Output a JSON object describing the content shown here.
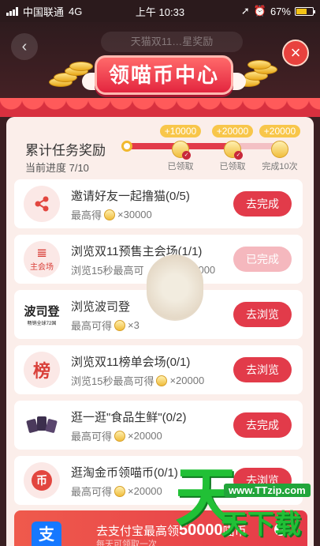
{
  "status_bar": {
    "carrier": "中国联通",
    "network": "4G",
    "time": "上午 10:33",
    "battery": "67%",
    "battery_level": 0.67
  },
  "header": {
    "banner_text": "天猫双11…星奖励",
    "title": "领喵币中心",
    "back_icon": "chevron-left-icon",
    "close_icon": "close-icon"
  },
  "progress": {
    "title": "累计任务奖励",
    "current": "当前进度 7/10",
    "fraction": 0.7,
    "milestones": [
      {
        "amount": "+10000",
        "state": "已领取"
      },
      {
        "amount": "+20000",
        "state": "已领取"
      },
      {
        "amount": "+20000",
        "state": "完成10次"
      }
    ]
  },
  "tasks": [
    {
      "icon": "share-icon",
      "title": "邀请好友一起撸猫(0/5)",
      "desc": "最高得",
      "reward": "×30000",
      "button": "去完成",
      "done": false
    },
    {
      "icon": "main-venue-icon",
      "icon_label": "主会场",
      "title": "浏览双11预售主会场(1/1)",
      "desc": "浏览15秒最高可",
      "reward": "000",
      "button": "已完成",
      "done": true
    },
    {
      "icon": "bosideng-logo",
      "icon_label": "波司登",
      "icon_sublabel": "畅销全球72国",
      "title": "浏览波司登",
      "title_tail": "0)",
      "desc": "最高可得",
      "reward": "×3",
      "button": "去浏览",
      "done": false
    },
    {
      "icon": "ranking-icon",
      "icon_label": "榜",
      "title": "浏览双11榜单会场(0/1)",
      "desc": "浏览15秒最高可得",
      "reward": "×20000",
      "button": "去浏览",
      "done": false
    },
    {
      "icon": "snack-icon",
      "title": "逛一逛\"食品生鲜\"(0/2)",
      "desc": "最高可得",
      "reward": "×20000",
      "button": "去完成",
      "done": false
    },
    {
      "icon": "taobao-coin-icon",
      "icon_label": "币",
      "title": "逛淘金币领喵币(0/1)",
      "desc": "最高可得",
      "reward": "×20000",
      "button": "去浏览",
      "done": false
    }
  ],
  "ali_banner": {
    "logo": "支",
    "text": "去支付宝最高领",
    "amount": "50000",
    "unit": "喵币",
    "sub": "每天可领取一次"
  },
  "watermark": {
    "big": "天",
    "url": "www.TTzip.com",
    "cn": "天下载"
  }
}
